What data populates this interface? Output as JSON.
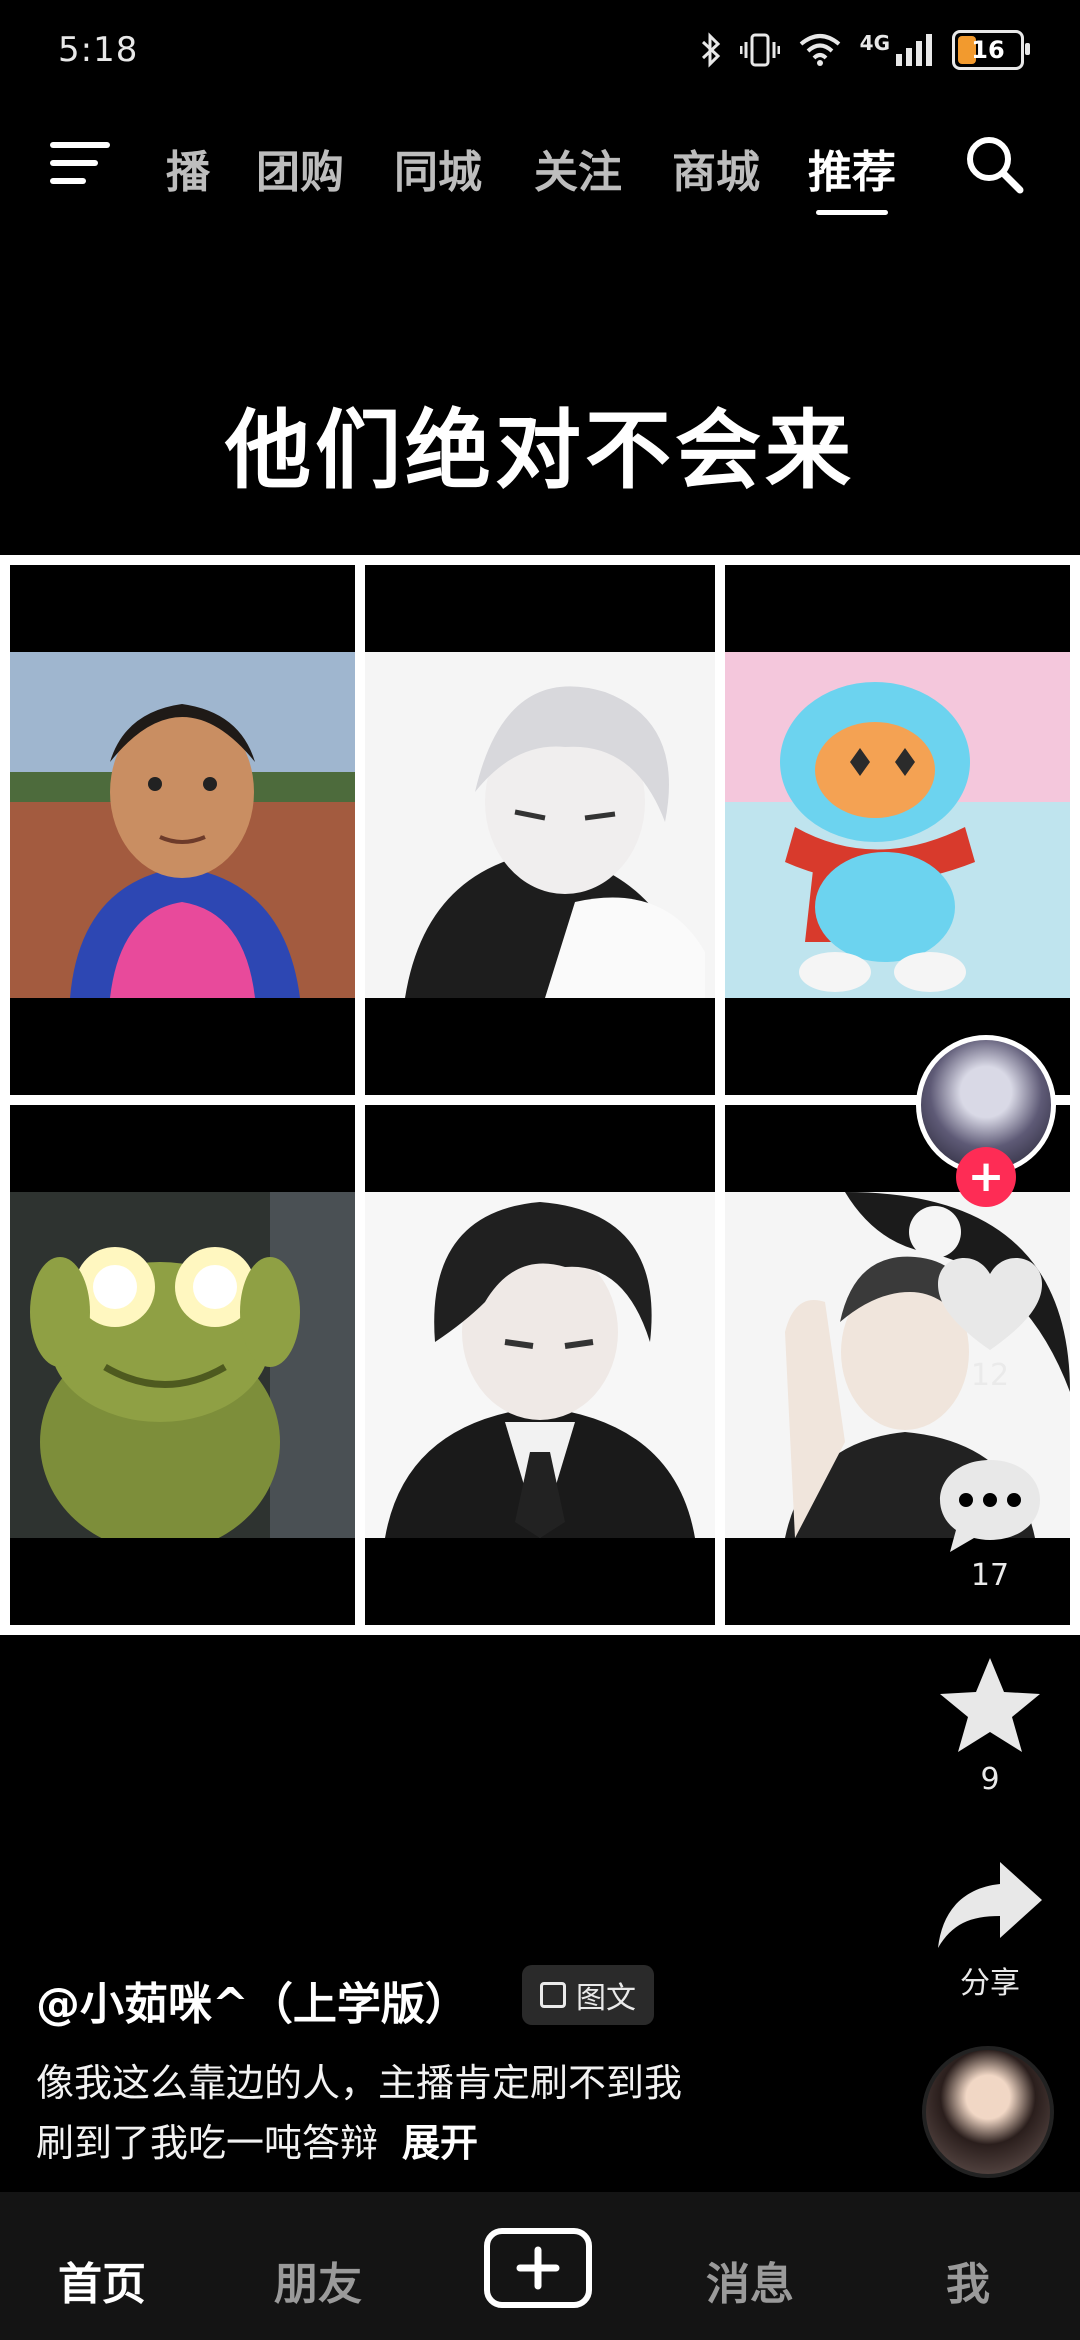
{
  "status_bar": {
    "time": "5:18",
    "network": "4G",
    "battery": "16"
  },
  "top_nav": {
    "tabs": [
      {
        "label": "播",
        "active": false
      },
      {
        "label": "团购",
        "active": false
      },
      {
        "label": "同城",
        "active": false
      },
      {
        "label": "关注",
        "active": false
      },
      {
        "label": "商城",
        "active": false
      },
      {
        "label": "推荐",
        "active": true
      }
    ]
  },
  "post": {
    "title": "他们绝对不会来",
    "grid_images": [
      {
        "icon": "photo-man-track"
      },
      {
        "icon": "anime-boy-white-hair"
      },
      {
        "icon": "cartoon-mascot"
      },
      {
        "icon": "frog-glowing-eyes"
      },
      {
        "icon": "anime-boy-dark-hair"
      },
      {
        "icon": "anime-man-yin-yang"
      }
    ]
  },
  "actions": {
    "like_count": "12",
    "comment_count": "17",
    "favorite_count": "9",
    "share_label": "分享",
    "follow_symbol": "+"
  },
  "author": {
    "name": "@小茹咪^（上学版）",
    "type_badge": "图文"
  },
  "caption": {
    "line1": "像我这么靠边的人，主播肯定刷不到我",
    "line2": "刷到了我吃一吨答辩",
    "expand": "展开"
  },
  "bottom_nav": {
    "home": "首页",
    "friends": "朋友",
    "messages": "消息",
    "me": "我"
  },
  "colors": {
    "accent": "#fe2c55",
    "background": "#000000",
    "bottom_bar": "#141414"
  }
}
